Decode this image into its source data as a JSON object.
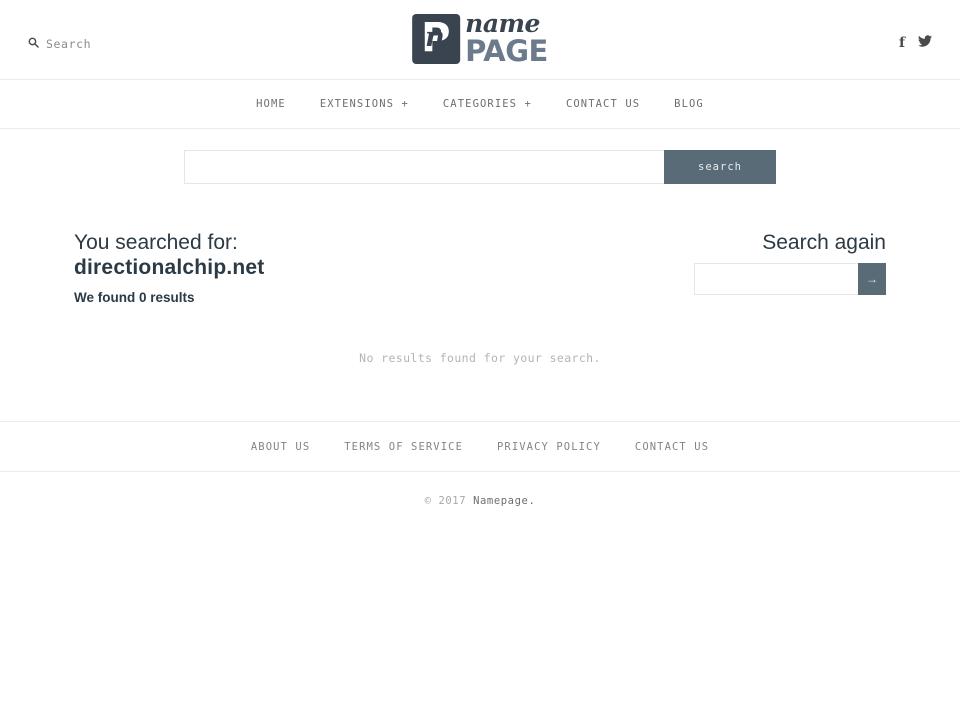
{
  "header": {
    "search_link_label": "Search",
    "search_icon": "search-icon",
    "logo": {
      "mark_letter": "P",
      "mark_script": "n",
      "word_top": "name",
      "word_bottom": "PAGE"
    },
    "social": [
      {
        "name": "facebook",
        "glyph": "f"
      },
      {
        "name": "twitter",
        "glyph": "twitter-bird-icon"
      }
    ]
  },
  "nav": {
    "items": [
      {
        "label": "HOME"
      },
      {
        "label": "EXTENSIONS +"
      },
      {
        "label": "CATEGORIES +"
      },
      {
        "label": "CONTACT US"
      },
      {
        "label": "BLOG"
      }
    ]
  },
  "search_form": {
    "value": "",
    "placeholder": "",
    "button_label": "search"
  },
  "results": {
    "searched_label": "You searched for:",
    "searched_term": "directionalchip.net",
    "found_text": "We found 0 results",
    "empty_message": "No results found for your search."
  },
  "search_again": {
    "title": "Search again",
    "value": "",
    "placeholder": "",
    "button_label": "→"
  },
  "footer": {
    "links": [
      {
        "label": "ABOUT US"
      },
      {
        "label": "TERMS OF SERVICE"
      },
      {
        "label": "PRIVACY POLICY"
      },
      {
        "label": "CONTACT US"
      }
    ],
    "copyright_prefix": "© 2017 ",
    "copyright_brand": "Namepage."
  },
  "colors": {
    "accent": "#5a6b78",
    "heading": "#2b3a45",
    "logo_dark": "#3a4350",
    "logo_light": "#6b7a8c",
    "divider": "#ebebeb",
    "muted": "#b4b4b4"
  }
}
